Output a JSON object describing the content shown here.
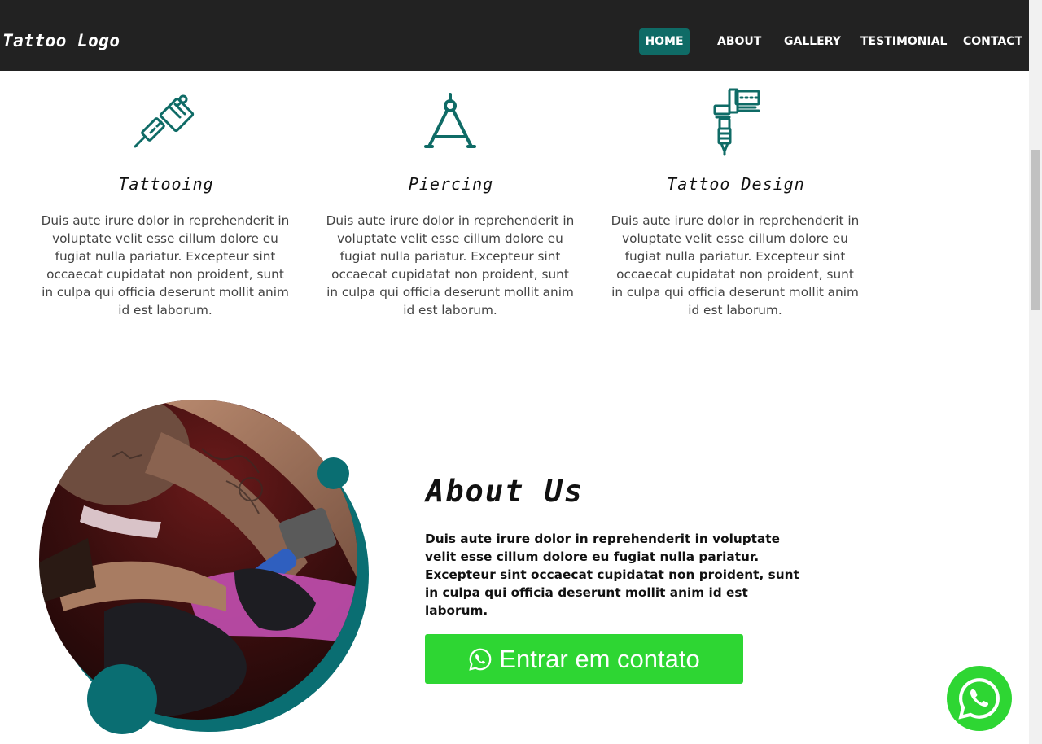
{
  "header": {
    "logo": "Tattoo Logo",
    "nav": [
      {
        "label": "HOME",
        "active": true
      },
      {
        "label": "ABOUT",
        "active": false
      },
      {
        "label": "GALLERY",
        "active": false
      },
      {
        "label": "TESTIMONIAL",
        "active": false
      },
      {
        "label": "CONTACT",
        "active": false
      }
    ]
  },
  "services": [
    {
      "icon": "tattoo-machine-icon",
      "title": "Tattooing",
      "text": "Duis aute irure dolor in reprehenderit in voluptate velit esse cillum dolore eu fugiat nulla pariatur. Excepteur sint occaecat cupidatat non proident, sunt in culpa qui officia deserunt mollit anim id est laborum."
    },
    {
      "icon": "compass-icon",
      "title": "Piercing",
      "text": "Duis aute irure dolor in reprehenderit in voluptate velit esse cillum dolore eu fugiat nulla pariatur. Excepteur sint occaecat cupidatat non proident, sunt in culpa qui officia deserunt mollit anim id est laborum."
    },
    {
      "icon": "tattoo-gun-icon",
      "title": "Tattoo Design",
      "text": "Duis aute irure dolor in reprehenderit in voluptate velit esse cillum dolore eu fugiat nulla pariatur. Excepteur sint occaecat cupidatat non proident, sunt in culpa qui officia deserunt mollit anim id est laborum."
    }
  ],
  "about": {
    "title": "About Us",
    "text": "Duis aute irure dolor in reprehenderit in voluptate velit esse cillum dolore eu fugiat nulla pariatur. Excepteur sint occaecat cupidatat non proident, sunt in culpa qui officia deserunt mollit anim id est laborum.",
    "button_label": "Entrar em contato",
    "button_icon": "whatsapp-icon"
  },
  "floating_button": {
    "icon": "whatsapp-icon"
  },
  "colors": {
    "nav_bg": "#222222",
    "accent": "#0f6b66",
    "whatsapp_green": "#2ed633"
  }
}
